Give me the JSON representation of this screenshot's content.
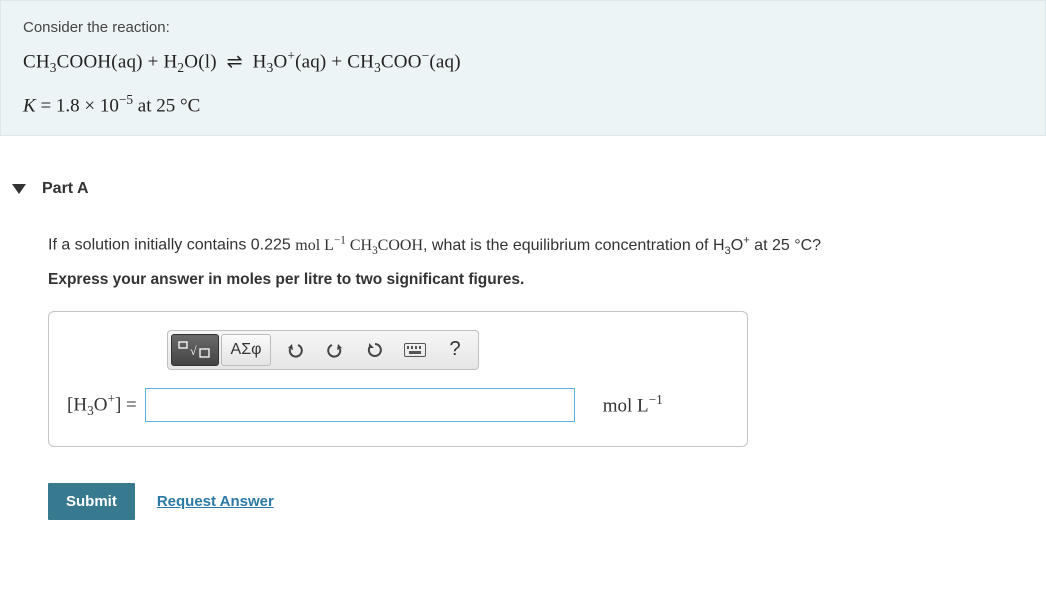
{
  "intro": {
    "prompt": "Consider the reaction:",
    "reaction_html": "CH<sub>3</sub>COOH(aq) + H<sub>2</sub>O(l) &nbsp;⇌&nbsp; H<sub>3</sub>O<sup>+</sup>(aq) + CH<sub>3</sub>COO<sup>−</sup>(aq)",
    "k_html": "<i>K</i> = 1.8 × 10<sup>−5</sup> at 25 °C"
  },
  "part": {
    "label": "Part A",
    "question_prefix": "If a solution initially contains 0.225 ",
    "question_units_html": "mol L<sup>−1</sup>",
    "question_species_html": " CH<sub>3</sub>COOH",
    "question_suffix_html": ", what is the equilibrium concentration of H<sub>3</sub>O<sup>+</sup> at 25 °C?",
    "instructions": "Express your answer in moles per litre to two significant figures.",
    "toolbar": {
      "templates_label": "templates",
      "greek_label": "ΑΣφ",
      "help_label": "?"
    },
    "answer": {
      "lhs_html": "[H<sub>3</sub>O<sup>+</sup>] =",
      "value": "",
      "unit_html": "mol L<sup>−1</sup>"
    },
    "actions": {
      "submit": "Submit",
      "request": "Request Answer"
    }
  }
}
